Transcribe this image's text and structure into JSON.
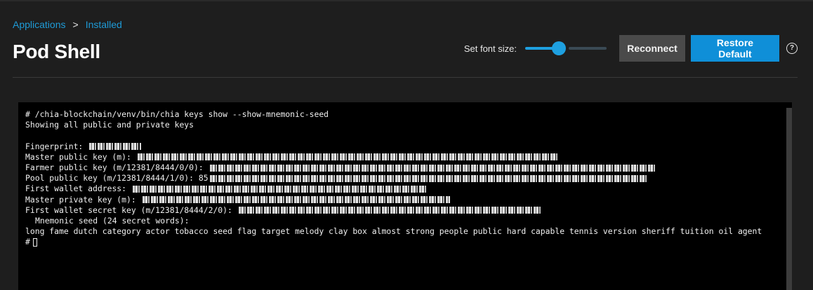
{
  "breadcrumb": {
    "items": [
      "Applications",
      "Installed"
    ],
    "separator": ">"
  },
  "page": {
    "title": "Pod Shell"
  },
  "controls": {
    "font_size_label": "Set font size:",
    "font_size_level": 0.41,
    "reconnect_label": "Reconnect",
    "restore_label": "Restore Default",
    "help_icon": "help-circle-icon",
    "help_glyph": "?"
  },
  "colors": {
    "accent": "#0f8fd8",
    "link": "#1e9bd7",
    "background": "#1e1e1e",
    "terminal_bg": "#000000"
  },
  "terminal": {
    "command": "# /chia-blockchain/venv/bin/chia keys show --show-mnemonic-seed",
    "header": "Showing all public and private keys",
    "fields": [
      {
        "label": "Fingerprint: "
      },
      {
        "label": "Master public key (m): "
      },
      {
        "label": "Farmer public key (m/12381/8444/0/0): "
      },
      {
        "label": "Pool public key (m/12381/8444/1/0): 85"
      },
      {
        "label": "First wallet address: "
      },
      {
        "label": "Master private key (m): "
      },
      {
        "label": "First wallet secret key (m/12381/8444/2/0): "
      }
    ],
    "mnemonic_label": "Mnemonic seed (24 secret words):",
    "mnemonic": "long fame dutch category actor tobacco seed flag target melody clay box almost strong people public hard capable tennis version sheriff tuition oil agent",
    "prompt": "#"
  }
}
